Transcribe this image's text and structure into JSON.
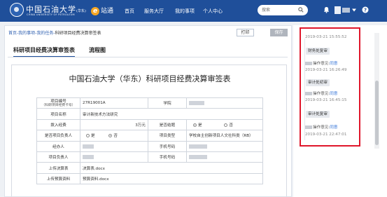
{
  "header": {
    "logo_cn": "中国石油大学",
    "logo_suffix": "(华东)",
    "logo_en": "CHINA UNIVERSITY OF PETROLEUM",
    "app_name": "e站通",
    "app_letter": "e",
    "app_word": "站通",
    "nav": [
      "首页",
      "服务大厅",
      "我的事项",
      "个人中心"
    ],
    "search_placeholder": "搜索",
    "colors": {
      "bar": "#1f4f9a",
      "accent": "#f5a623"
    }
  },
  "breadcrumb": {
    "path": "首页-我的事项-我的任务-",
    "current": "科研项目经费决算审签表"
  },
  "toolbar": {
    "print_label": "打印",
    "save_label": "保存"
  },
  "tabs": [
    "科研项目经费决算审签表",
    "流程图"
  ],
  "form": {
    "title": "中国石油大学（华东）科研项目经费决算审签表",
    "rows": {
      "project_no_label": "项目编号",
      "project_no_sub": "（科研项目经费卡号）",
      "project_no": "27R19001A",
      "college_label": "学院",
      "project_name_label": "项目名称",
      "project_name": "审计新技术方法研究",
      "funding_label": "拨入经费",
      "funding": "3万元",
      "is_closed_label": "是否结题",
      "yes": "是",
      "no": "否",
      "pi_confirm_label": "是否项目负责人",
      "project_type_label": "项目类型",
      "project_type": "学校自主创新项目人文社科类（RB）",
      "handler_label": "经办人",
      "phone_label": "手机号码",
      "pi_label": "项目负责人",
      "upload_final_label": "上传决算表",
      "upload_final": "决算表.docx",
      "upload_budget_label": "上传预算资料",
      "upload_budget": "预算资料.docx"
    }
  },
  "timeline": {
    "op_label": "操作意见:",
    "entries": [
      {
        "time": "2019-03-21 15:55:52",
        "step": "财务处复审",
        "time2": "2019-03-21 16:26:49",
        "opinion": "同意"
      },
      {
        "step": "审计处初审",
        "time2": "2019-03-21 16:45:15",
        "opinion": "同意"
      },
      {
        "step": "审计处复审",
        "time2": "2019-03-21 22:47:01",
        "opinion": "同意"
      }
    ]
  }
}
